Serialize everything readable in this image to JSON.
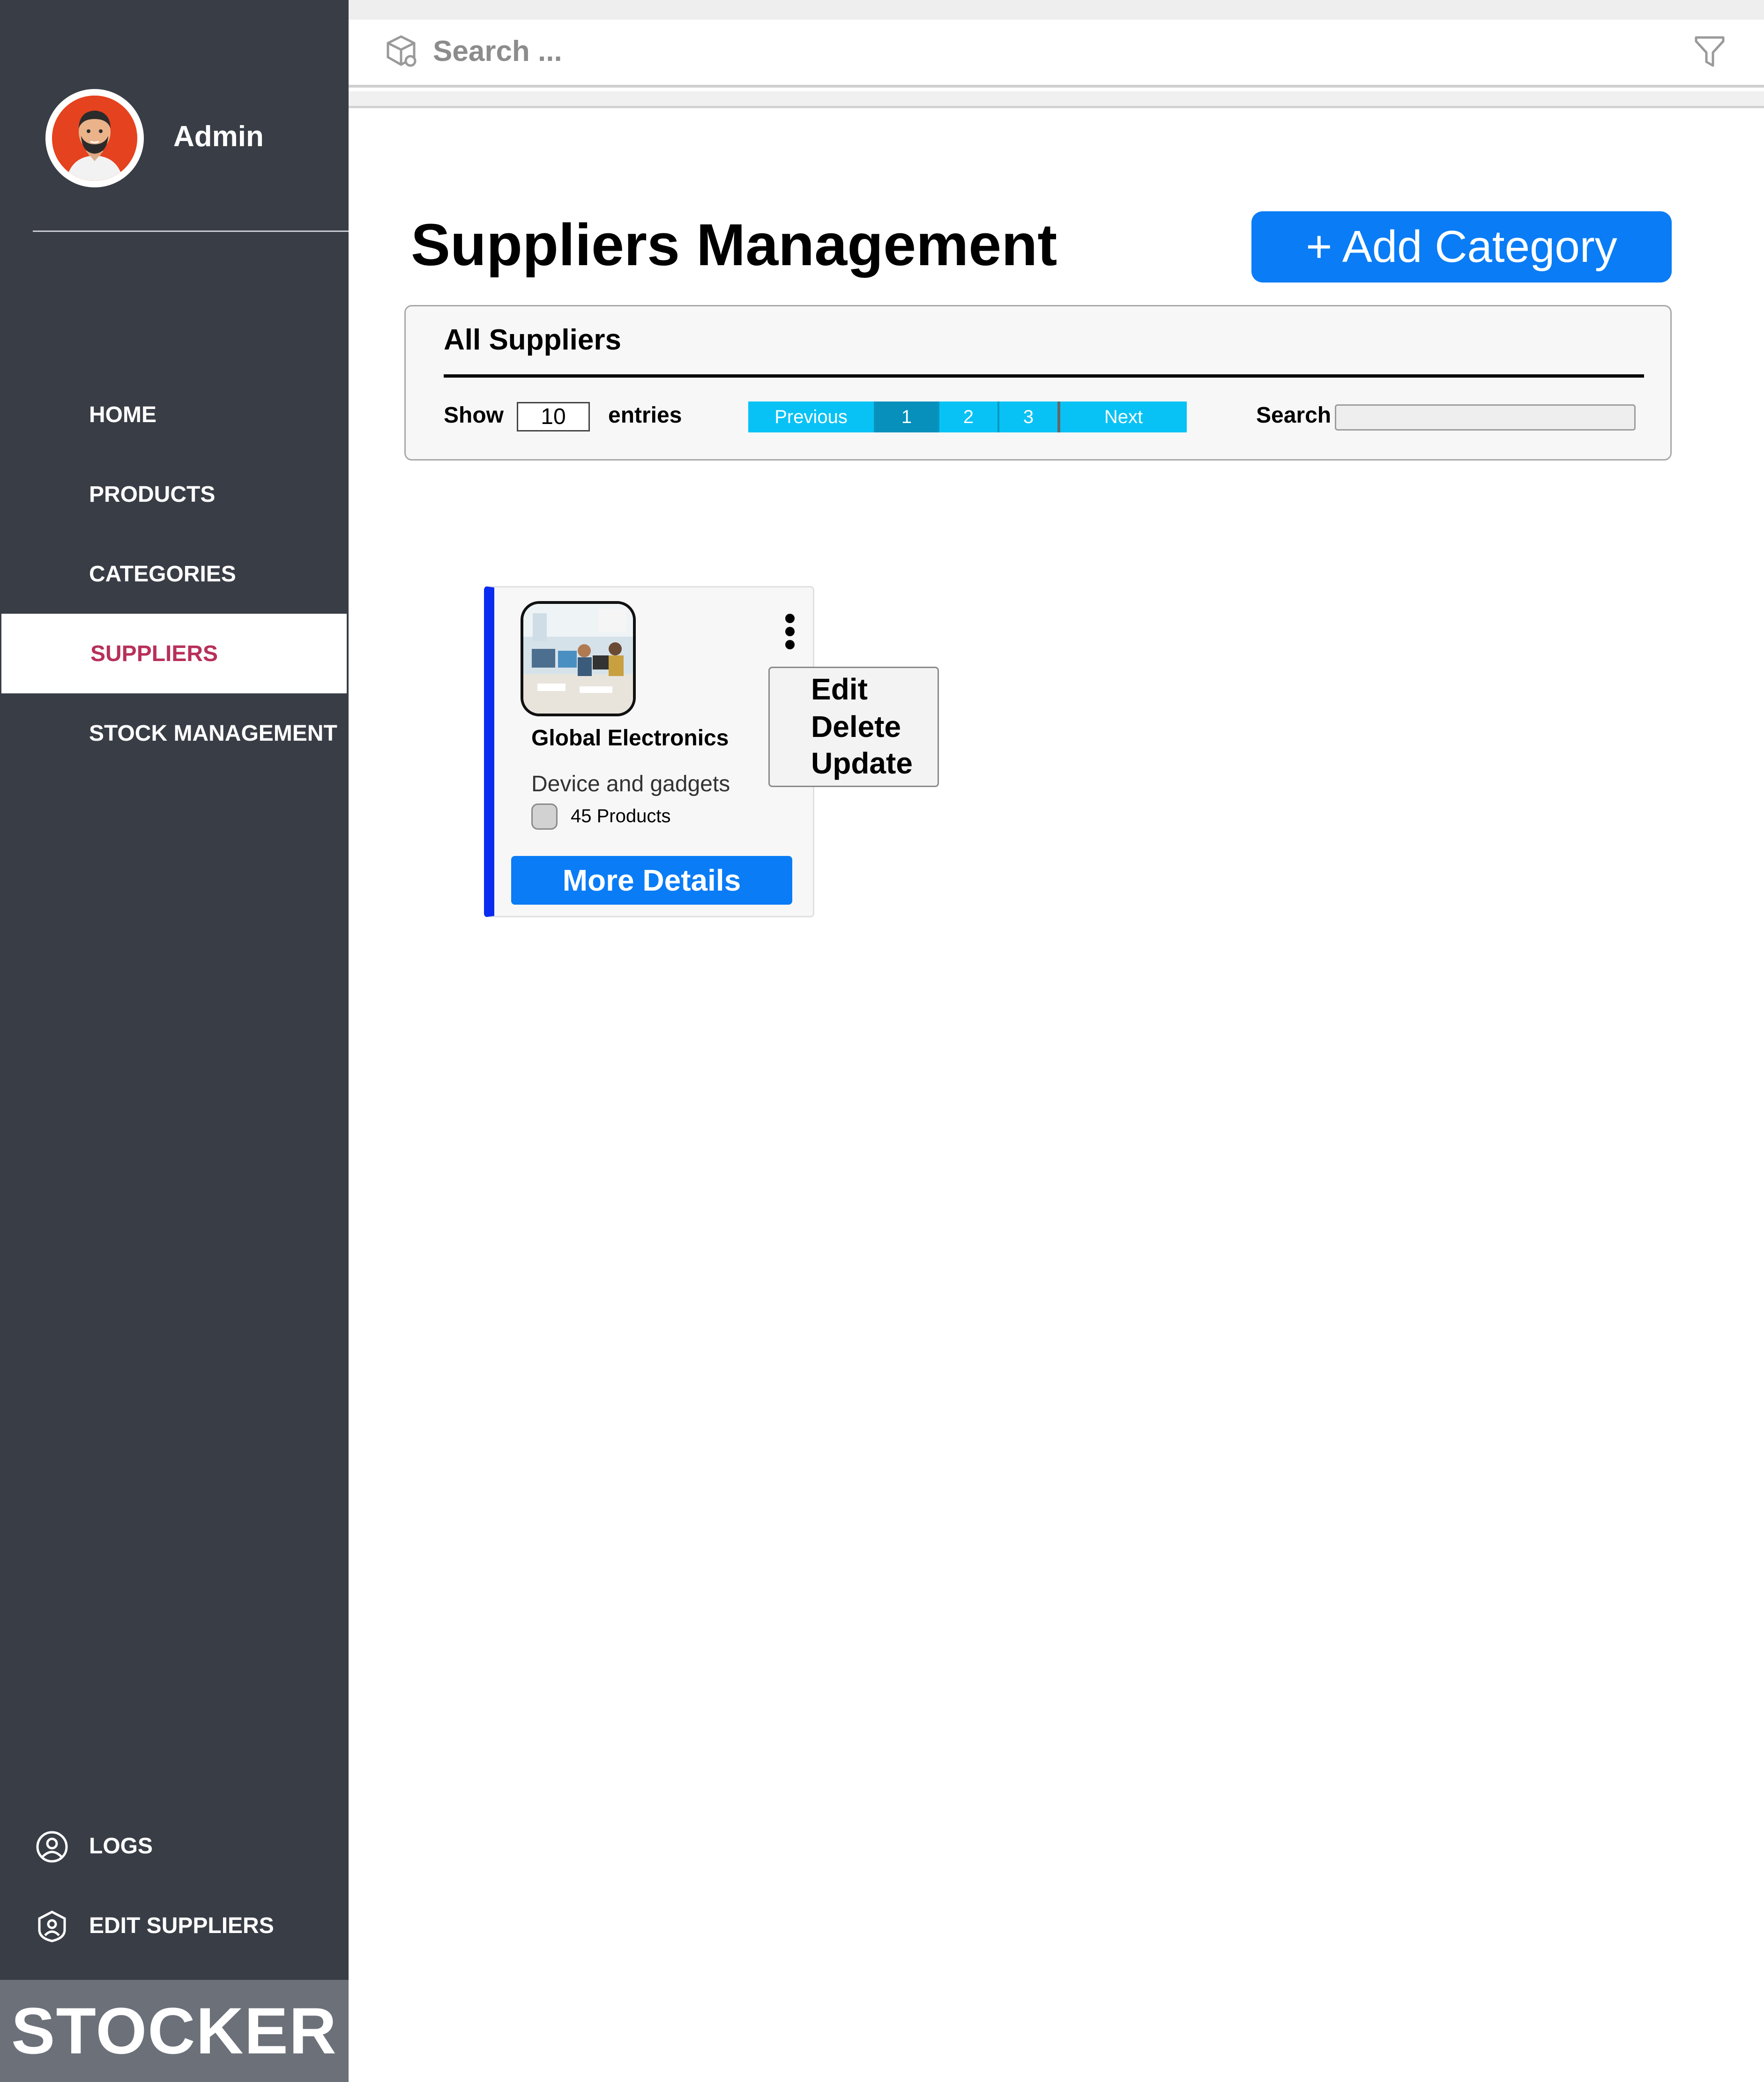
{
  "user": {
    "name": "Admin"
  },
  "nav": {
    "items": [
      {
        "label": "HOME",
        "active": false
      },
      {
        "label": "PRODUCTS",
        "active": false
      },
      {
        "label": "CATEGORIES",
        "active": false
      },
      {
        "label": "SUPPLIERS",
        "active": true
      },
      {
        "label": "STOCK MANAGEMENT",
        "active": false
      }
    ],
    "bottom": [
      {
        "label": "LOGS",
        "icon": "user-circle-icon"
      },
      {
        "label": "EDIT SUPPLIERS",
        "icon": "user-shield-icon"
      }
    ]
  },
  "brand": "STOCKER",
  "topbar": {
    "search_placeholder": "Search ...",
    "search_icon": "package-search-icon",
    "filter_icon": "filter-icon"
  },
  "page": {
    "title": "Suppliers Management",
    "add_button": "+ Add Category"
  },
  "panel": {
    "title": "All Suppliers",
    "show_label": "Show",
    "entries_value": "10",
    "entries_label": "entries",
    "pagination": {
      "previous": "Previous",
      "pages": [
        "1",
        "2",
        "3"
      ],
      "current": "1",
      "next": "Next"
    },
    "search_label": "Search",
    "search_value": ""
  },
  "supplier_card": {
    "name": "Global Electronics",
    "description": "Device and gadgets",
    "products_count": "45 Products",
    "button": "More Details",
    "menu": [
      "Edit",
      "Delete",
      "Update"
    ]
  },
  "colors": {
    "sidebar": "#393d46",
    "active_nav_text": "#b8305a",
    "primary_button": "#0a7cf6",
    "pager": "#08c2f5",
    "card_accent": "#0a2cf0"
  }
}
